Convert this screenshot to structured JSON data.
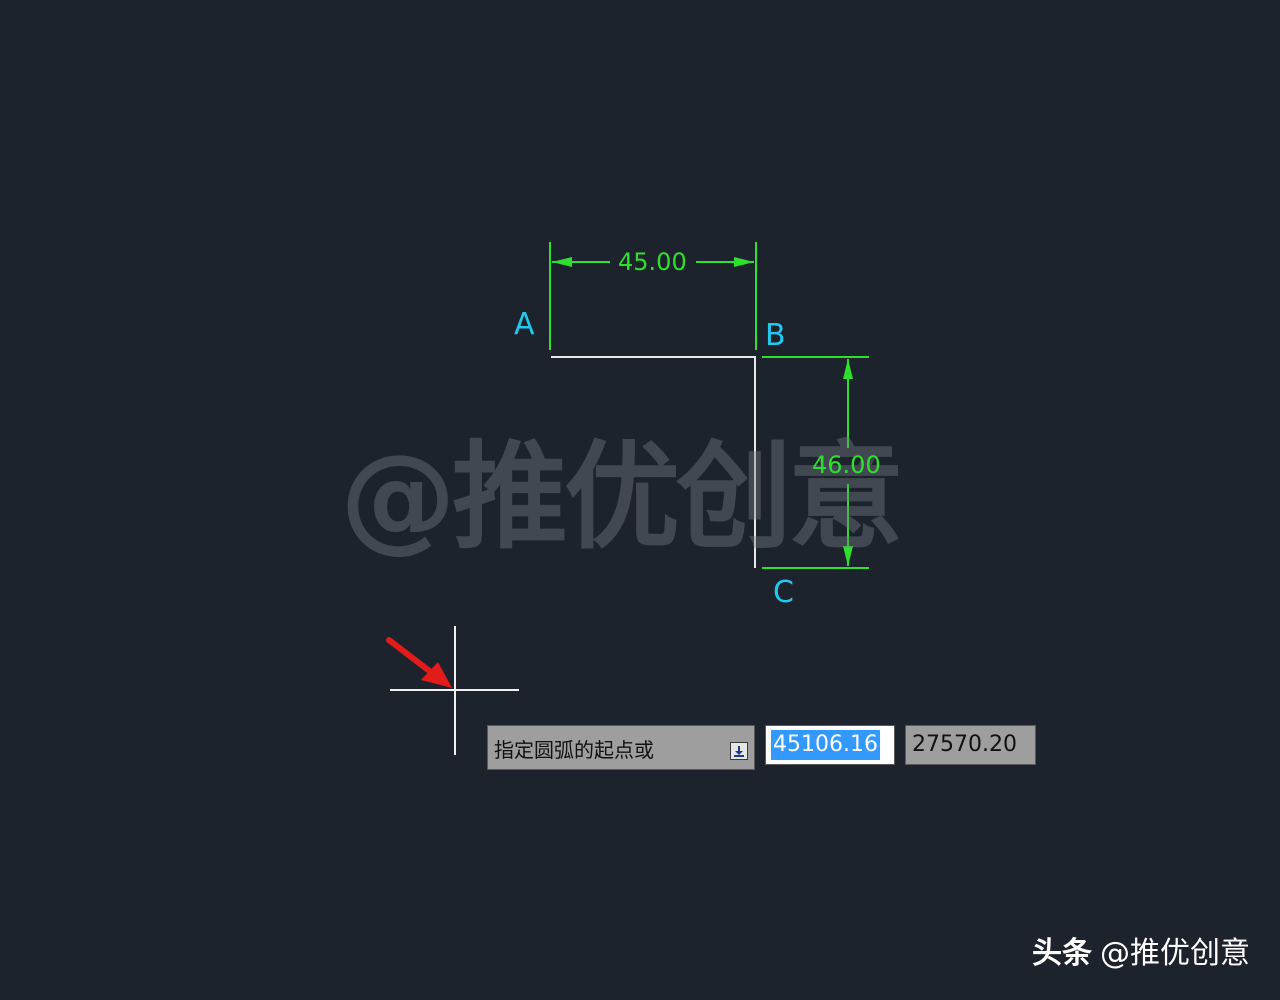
{
  "canvas": {
    "background": "#1d232d",
    "geometry_color": "#e8e8e8",
    "dimension_color": "#2ee02e",
    "point_label_color": "#22c8ef",
    "annotation_arrow_color": "#e21b1b"
  },
  "points": {
    "a": "A",
    "b": "B",
    "c": "C"
  },
  "dimensions": {
    "horizontal": "45.00",
    "vertical": "46.00"
  },
  "watermark": "@推优创意",
  "command_input": {
    "prompt": "指定圆弧的起点或",
    "options_icon": "down-arrow-box-icon",
    "x_value": "45106.16",
    "y_value": "27570.20"
  },
  "brand": {
    "platform": "头条",
    "handle": "@推优创意"
  }
}
